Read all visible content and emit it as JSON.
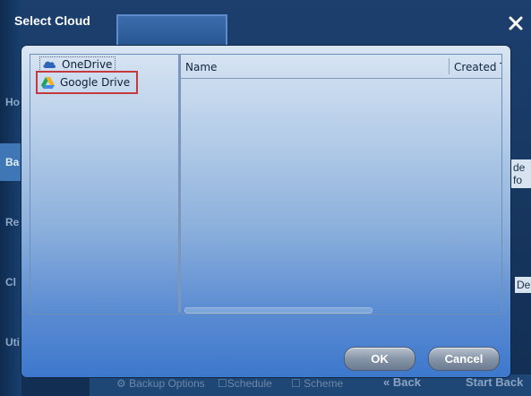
{
  "background": {
    "sidebar_items": [
      "Ho",
      "Ba",
      "Re",
      "Cl",
      "Uti"
    ],
    "right_texts": [
      "de fo",
      "De"
    ],
    "bottom_items": [
      "Backup Options",
      "Schedule",
      "Scheme"
    ],
    "back_label": "Back",
    "start_label": "Start Back"
  },
  "dialog": {
    "title": "Select Cloud",
    "close_glyph": "✕",
    "tree": [
      {
        "label": "OneDrive",
        "icon": "onedrive-cloud-icon"
      },
      {
        "label": "Google Drive",
        "icon": "google-drive-icon",
        "selected": true
      }
    ],
    "list": {
      "columns": [
        "Name",
        "Created T"
      ]
    },
    "ok_label": "OK",
    "cancel_label": "Cancel"
  }
}
